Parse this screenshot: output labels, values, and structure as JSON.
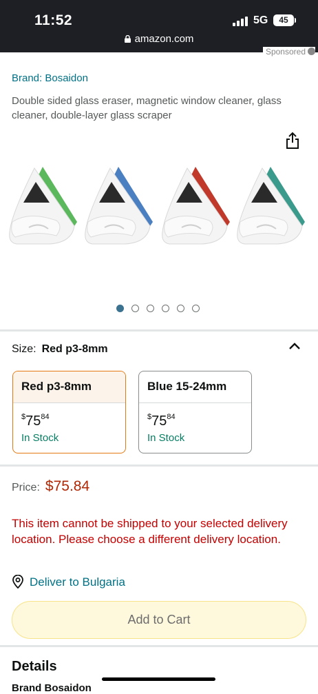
{
  "status_bar": {
    "time": "11:52",
    "network": "5G",
    "battery": "45",
    "url": "amazon.com"
  },
  "sponsored": "Sponsored",
  "product": {
    "brand": "Brand: Bosaidon",
    "title": "Double sided glass eraser, magnetic window cleaner, glass cleaner, double-layer glass scraper",
    "image_colors": [
      "#5cb85c",
      "#4a7fc1",
      "#c0392b",
      "#3a9a8c"
    ],
    "carousel_count": 6,
    "carousel_active": 1
  },
  "size": {
    "label": "Size:",
    "selected": "Red p3-8mm",
    "options": [
      {
        "name": "Red p3-8mm",
        "price_symbol": "$",
        "price_whole": "75",
        "price_fraction": "84",
        "stock": "In Stock",
        "selected": true
      },
      {
        "name": "Blue 15-24mm",
        "price_symbol": "$",
        "price_whole": "75",
        "price_fraction": "84",
        "stock": "In Stock",
        "selected": false
      }
    ]
  },
  "price": {
    "label": "Price:",
    "value": "$75.84"
  },
  "shipping_warning": "This item cannot be shipped to your selected delivery location. Please choose a different delivery location.",
  "deliver_to": "Deliver to Bulgaria",
  "add_to_cart": "Add to Cart",
  "details": {
    "heading": "Details",
    "brand_peek": "Brand Bosaidon"
  },
  "colors": {
    "link": "#007185",
    "price": "#b12704",
    "warning": "#c40000",
    "stock": "#067d62",
    "selected_border": "#e47911"
  }
}
